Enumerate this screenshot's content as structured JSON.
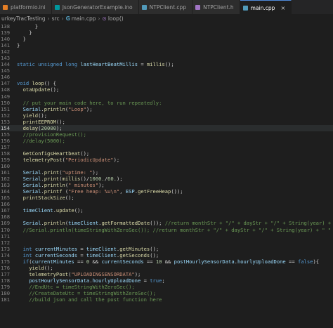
{
  "tabs": [
    {
      "label": "platformio.ini",
      "icon": "ini-file-icon",
      "color": "#e57e25",
      "active": false
    },
    {
      "label": "JsonGeneratorExample.ino",
      "icon": "ino-file-icon",
      "color": "#00979d",
      "active": false
    },
    {
      "label": "NTPClient.cpp",
      "icon": "cpp-file-icon",
      "color": "#519aba",
      "active": false
    },
    {
      "label": "NTPClient.h",
      "icon": "h-file-icon",
      "color": "#a074c4",
      "active": false
    },
    {
      "label": "main.cpp",
      "icon": "cpp-file-icon",
      "color": "#519aba",
      "active": true
    }
  ],
  "close_glyph": "×",
  "breadcrumb": {
    "project": "urkeyTracTesting",
    "folder": "src",
    "file": "main.cpp",
    "symbol": "loop()"
  },
  "lines": [
    {
      "n": "138",
      "code": "      }"
    },
    {
      "n": "139",
      "code": "    }"
    },
    {
      "n": "140",
      "code": "  }"
    },
    {
      "n": "141",
      "code": "}"
    },
    {
      "n": "142",
      "code": ""
    },
    {
      "n": "143",
      "code": ""
    },
    {
      "n": "144",
      "code": "static unsigned long lastHeartBeatMillis = millis();"
    },
    {
      "n": "145",
      "code": ""
    },
    {
      "n": "146",
      "code": ""
    },
    {
      "n": "147",
      "code": "void loop() {"
    },
    {
      "n": "148",
      "code": "  otaUpdate();"
    },
    {
      "n": "149",
      "code": ""
    },
    {
      "n": "150",
      "code": "  // put your main code here, to run repeatedly:"
    },
    {
      "n": "151",
      "code": "  Serial.println(\"Loop\");"
    },
    {
      "n": "152",
      "code": "  yield();"
    },
    {
      "n": "153",
      "code": "  printEEPROM();"
    },
    {
      "n": "154",
      "code": "  delay(20000);"
    },
    {
      "n": "155",
      "code": "  //provisionRequest();"
    },
    {
      "n": "156",
      "code": "  //delay(5000);"
    },
    {
      "n": "157",
      "code": ""
    },
    {
      "n": "158",
      "code": "  GetConfigsHeartbeat();"
    },
    {
      "n": "159",
      "code": "  telemetryPost(\"PeriodicUpdate\");"
    },
    {
      "n": "160",
      "code": ""
    },
    {
      "n": "161",
      "code": "  Serial.print(\"uptime: \");"
    },
    {
      "n": "162",
      "code": "  Serial.print(millis()/1000./60.);"
    },
    {
      "n": "163",
      "code": "  Serial.println(\" minutes\");"
    },
    {
      "n": "164",
      "code": "  Serial.printf (\"Free heap: %u\\n\", ESP.getFreeHeap());"
    },
    {
      "n": "165",
      "code": "  printStackSize();"
    },
    {
      "n": "166",
      "code": ""
    },
    {
      "n": "167",
      "code": "  timeClient.update();"
    },
    {
      "n": "168",
      "code": ""
    },
    {
      "n": "169",
      "code": "  Serial.println(timeClient.getFormattedDate()); //return monthStr + \"/\" + dayStr + \"/\" + String(year) + \" \" + this"
    },
    {
      "n": "170",
      "code": "  //Serial.println(timeStringWithZeroSec()); //return monthStr + \"/\" + dayStr + \"/\" + String(year) + \" \" + this->g"
    },
    {
      "n": "171",
      "code": ""
    },
    {
      "n": "172",
      "code": ""
    },
    {
      "n": "173",
      "code": "  int currentMinutes = timeClient.getMinutes();"
    },
    {
      "n": "174",
      "code": "  int currentSeconds = timeClient.getSeconds();"
    },
    {
      "n": "175",
      "code": "  if(currentMinutes == 0 && currentSeconds == 10 && postHourlySensorData.hourlyUploadDone == false){"
    },
    {
      "n": "176",
      "code": "    yield();"
    },
    {
      "n": "177",
      "code": "    telemetryPost(\"UPLOADINGSENSORDATA\");"
    },
    {
      "n": "178",
      "code": "    postHourlySensorData.hourlyUploadDone = true;"
    },
    {
      "n": "179",
      "code": "    //EndUtc = timeStringWithZeroSec();"
    },
    {
      "n": "180",
      "code": "    //CreateDateUtc = timeStringWithZeroSec();"
    },
    {
      "n": "181",
      "code": "    //build json and call the post function here"
    }
  ]
}
